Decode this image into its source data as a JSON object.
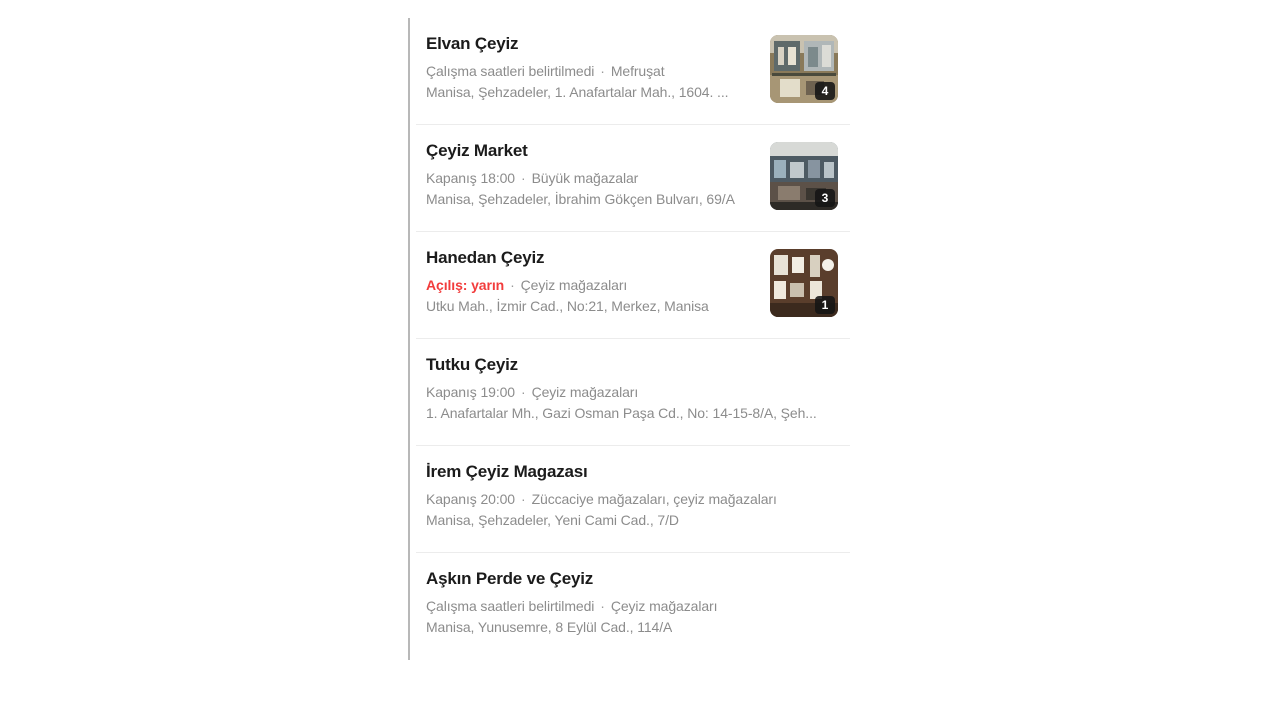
{
  "results": [
    {
      "title": "Elvan Çeyiz",
      "status": "Çalışma saatleri belirtilmedi",
      "status_highlight": false,
      "category": "Mefruşat",
      "address": "Manisa, Şehzadeler, 1. Anafartalar Mah., 1604. ...",
      "photo_count": "4"
    },
    {
      "title": "Çeyiz Market",
      "status": "Kapanış 18:00",
      "status_highlight": false,
      "category": "Büyük mağazalar",
      "address": "Manisa, Şehzadeler, İbrahim Gökçen Bulvarı, 69/A",
      "photo_count": "3"
    },
    {
      "title": "Hanedan Çeyiz",
      "status": "Açılış: yarın",
      "status_highlight": true,
      "category": "Çeyiz mağazaları",
      "address": "Utku Mah., İzmir Cad., No:21, Merkez, Manisa",
      "photo_count": "1"
    },
    {
      "title": "Tutku Çeyiz",
      "status": "Kapanış 19:00",
      "status_highlight": false,
      "category": "Çeyiz mağazaları",
      "address": "1. Anafartalar Mh., Gazi Osman Paşa Cd., No: 14-15-8/A, Şeh..."
    },
    {
      "title": "İrem Çeyiz Magazası",
      "status": "Kapanış 20:00",
      "status_highlight": false,
      "category": "Züccaciye mağazaları, çeyiz mağazaları",
      "address": "Manisa, Şehzadeler, Yeni Cami Cad., 7/D"
    },
    {
      "title": "Aşkın Perde ve Çeyiz",
      "status": "Çalışma saatleri belirtilmedi",
      "status_highlight": false,
      "category": "Çeyiz mağazaları",
      "address": "Manisa, Yunusemre, 8 Eylül Cad., 114/A"
    }
  ],
  "colors": {
    "status_highlight": "#f23c3c",
    "secondary_text": "#8c8c8c",
    "title_text": "#1b1b1b"
  },
  "separator": "·"
}
